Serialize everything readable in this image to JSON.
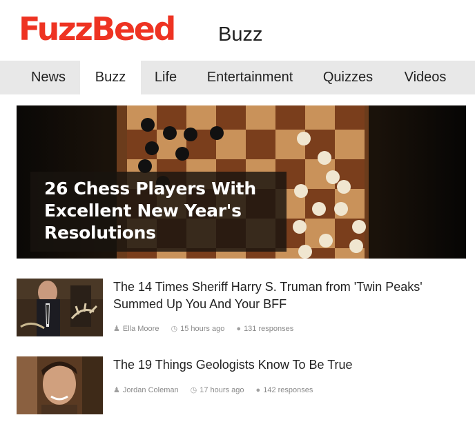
{
  "header": {
    "logo": "FuzzBeed",
    "section": "Buzz"
  },
  "nav": {
    "items": [
      {
        "label": "News",
        "active": false
      },
      {
        "label": "Buzz",
        "active": true
      },
      {
        "label": "Life",
        "active": false
      },
      {
        "label": "Entertainment",
        "active": false
      },
      {
        "label": "Quizzes",
        "active": false
      },
      {
        "label": "Videos",
        "active": false
      }
    ]
  },
  "hero": {
    "title": "26 Chess Players With Excellent New Year's Resolutions"
  },
  "articles": [
    {
      "title": "The 14 Times Sheriff Harry S. Truman from 'Twin Peaks' Summed Up You And Your BFF",
      "author": "Ella Moore",
      "time": "15 hours ago",
      "responses": "131 responses"
    },
    {
      "title": "The 19 Things Geologists Know To Be True",
      "author": "Jordan Coleman",
      "time": "17 hours ago",
      "responses": "142 responses"
    }
  ],
  "icons": {
    "author": "person-icon",
    "time": "clock-icon",
    "responses": "speech-bubble-icon"
  },
  "colors": {
    "brand": "#ee3322",
    "nav_bg": "#e8e8e8",
    "meta_text": "#8a8a8a"
  }
}
